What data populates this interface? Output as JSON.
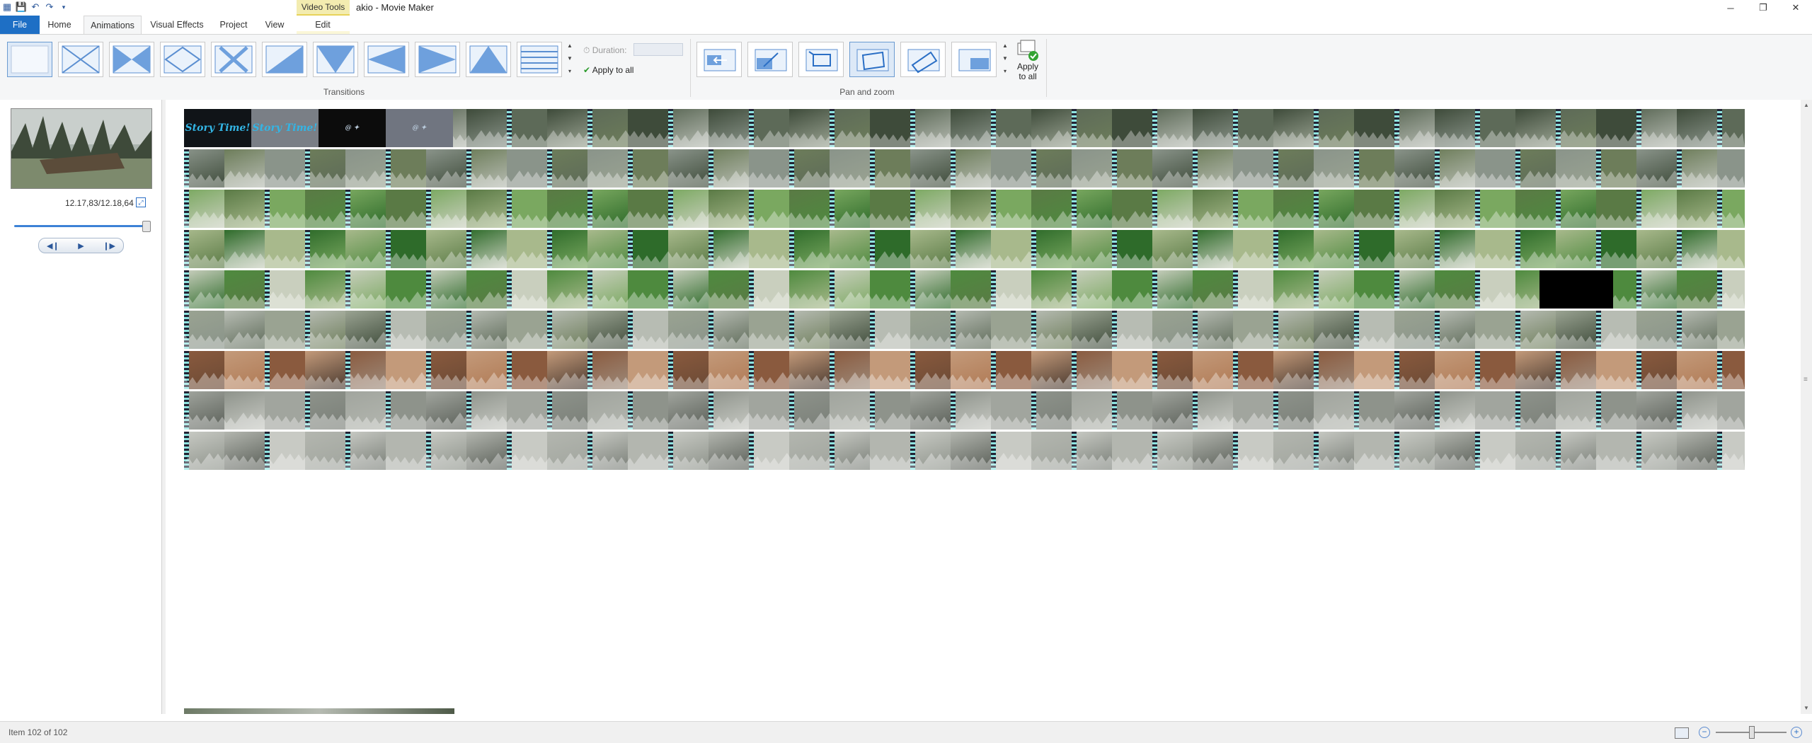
{
  "app": {
    "title": "akio - Movie Maker",
    "context_tab_group": "Video Tools"
  },
  "tabs": [
    {
      "label": "File"
    },
    {
      "label": "Home"
    },
    {
      "label": "Animations"
    },
    {
      "label": "Visual Effects"
    },
    {
      "label": "Project"
    },
    {
      "label": "View"
    },
    {
      "label": "Edit"
    }
  ],
  "ribbon": {
    "transitions": {
      "label": "Transitions",
      "duration_label": "Duration:",
      "duration_value": "",
      "apply_to_all": "Apply to all"
    },
    "pan_zoom": {
      "label": "Pan and zoom",
      "apply_to_all": "Apply to all"
    }
  },
  "preview": {
    "time": "12.17,83/12.18,64",
    "seek_fraction": 0.99
  },
  "status": {
    "item_text": "Item 102 of 102",
    "zoom_fraction": 0.5
  },
  "colors": {
    "accent": "#1e6fc5",
    "context_tab": "#f3ecb0",
    "ribbon_bg": "#f5f6f7"
  },
  "storyboard": {
    "title_cards": [
      "Story Time!",
      "Story Time!"
    ]
  }
}
